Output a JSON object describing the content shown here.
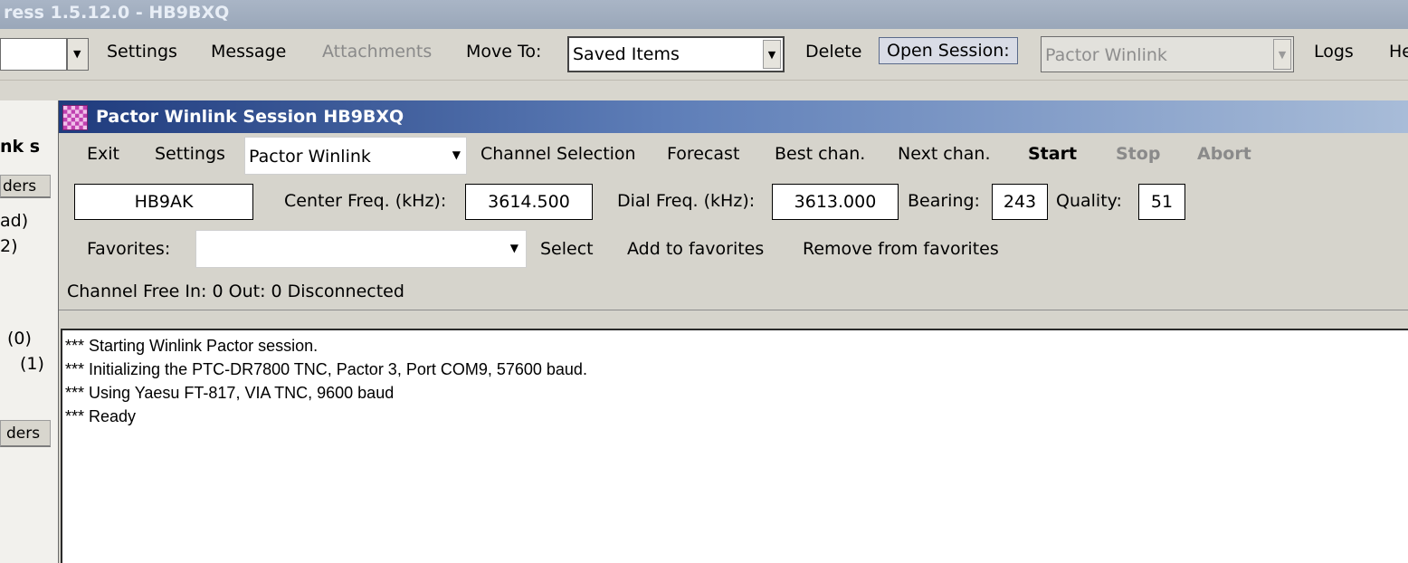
{
  "main_window": {
    "title": "ress 1.5.12.0 - HB9BXQ",
    "menu": {
      "settings": "Settings",
      "message": "Message",
      "attachments": "Attachments",
      "move_to": "Move To:",
      "move_to_value": "Saved Items",
      "delete": "Delete",
      "open_session": "Open Session:",
      "session_type": "Pactor Winlink",
      "logs": "Logs",
      "help": "He"
    }
  },
  "left_panel": {
    "header": "nk s",
    "folders_btn": "ders",
    "item1": "ad)",
    "item2": "2)",
    "item3": "(0)",
    "item4": "(1)",
    "folders_btn2": "ders"
  },
  "session": {
    "title": "Pactor Winlink Session HB9BXQ",
    "menu": {
      "exit": "Exit",
      "settings": "Settings",
      "mode": "Pactor Winlink",
      "channel_selection": "Channel Selection",
      "forecast": "Forecast",
      "best_chan": "Best chan.",
      "next_chan": "Next chan.",
      "start": "Start",
      "stop": "Stop",
      "abort": "Abort"
    },
    "station": "HB9AK",
    "center_freq_label": "Center Freq. (kHz):",
    "center_freq": "3614.500",
    "dial_freq_label": "Dial Freq. (kHz):",
    "dial_freq": "3613.000",
    "bearing_label": "Bearing:",
    "bearing": "243",
    "quality_label": "Quality:",
    "quality": "51",
    "favorites_label": "Favorites:",
    "select": "Select",
    "add_favorites": "Add to favorites",
    "remove_favorites": "Remove from favorites",
    "status": "Channel Free  In: 0  Out: 0  Disconnected",
    "log": [
      "*** Starting Winlink Pactor session.",
      "*** Initializing the PTC-DR7800 TNC,  Pactor 3,  Port COM9, 57600 baud.",
      "*** Using Yaesu FT-817, VIA TNC, 9600 baud",
      "*** Ready"
    ]
  }
}
